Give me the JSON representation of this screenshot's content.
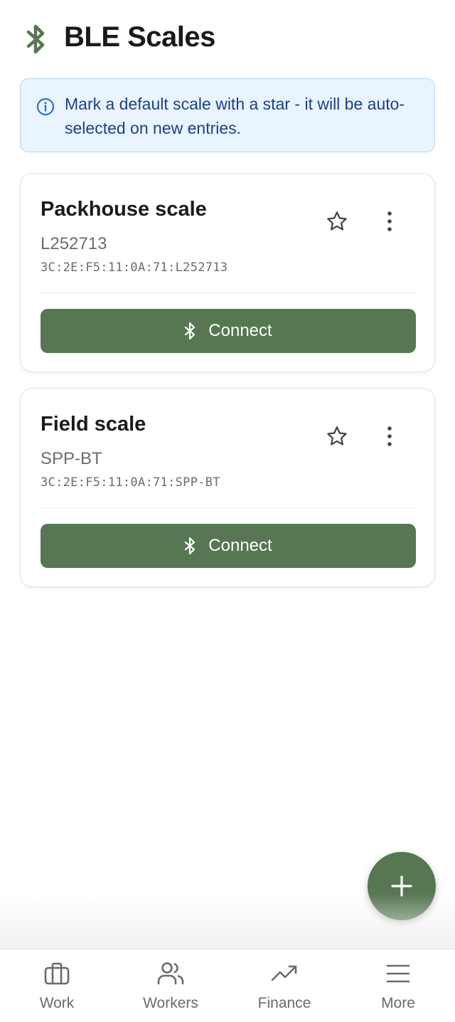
{
  "header": {
    "title": "BLE Scales",
    "icon": "bluetooth-icon",
    "accent_color": "#567752"
  },
  "info_banner": {
    "icon": "info-icon",
    "text": "Mark a default scale with a star - it will be auto-selected on new entries."
  },
  "scales": [
    {
      "name": "Packhouse scale",
      "model": "L252713",
      "address": "3C:2E:F5:11:0A:71:L252713",
      "starred": false,
      "connect_label": "Connect"
    },
    {
      "name": "Field scale",
      "model": "SPP-BT",
      "address": "3C:2E:F5:11:0A:71:SPP-BT",
      "starred": false,
      "connect_label": "Connect"
    }
  ],
  "fab": {
    "icon": "plus-icon"
  },
  "bottom_nav": {
    "items": [
      {
        "label": "Work",
        "icon": "briefcase-icon"
      },
      {
        "label": "Workers",
        "icon": "users-icon"
      },
      {
        "label": "Finance",
        "icon": "trending-up-icon"
      },
      {
        "label": "More",
        "icon": "menu-icon"
      }
    ]
  }
}
